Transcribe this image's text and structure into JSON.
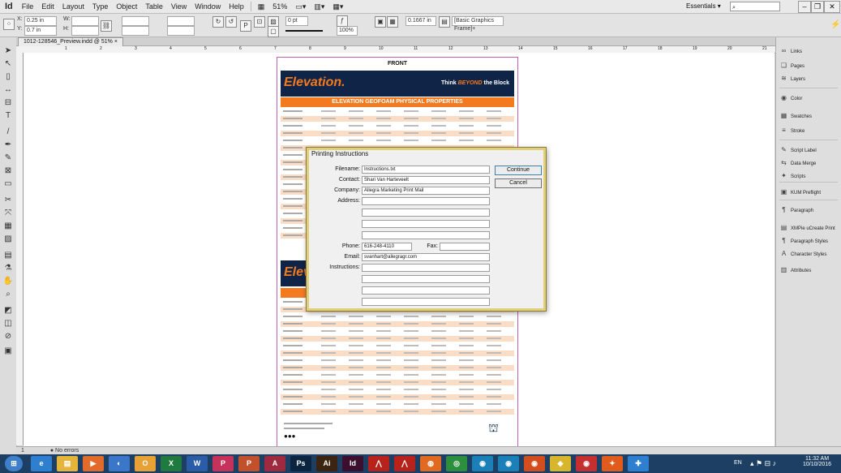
{
  "app": {
    "logo": "Id",
    "menu": [
      "File",
      "Edit",
      "Layout",
      "Type",
      "Object",
      "Table",
      "View",
      "Window",
      "Help"
    ],
    "zoom": "51%",
    "workspace": "Essentials",
    "window_buttons": [
      "–",
      "❐",
      "✕"
    ]
  },
  "controlbar": {
    "x": "0.25 in",
    "y": "0.7 in",
    "w_label": "W:",
    "h_label": "H:",
    "x_label": "X:",
    "y_label": "Y:",
    "stroke": "0 pt",
    "opacity": "100%",
    "width_value": "0.1667 in",
    "frame_style": "[Basic Graphics Frame]+"
  },
  "document": {
    "tab": "1012-128546_Preview.indd @ 51%",
    "close": "×",
    "ruler_ticks": [
      "1",
      "2",
      "3",
      "4",
      "5",
      "6",
      "7",
      "8",
      "9",
      "10",
      "11",
      "12",
      "13",
      "14",
      "15",
      "16",
      "17",
      "18",
      "19",
      "20",
      "21"
    ]
  },
  "page": {
    "title": "FRONT",
    "brand": "Elevation.",
    "tag_pre": "Think ",
    "tag_em": "BEYOND",
    "tag_post": " the Block",
    "heading": "ELEVATION GEOFOAM PHYSICAL PROPERTIES",
    "brand_small": "Elev"
  },
  "dialog": {
    "title": "Printing Instructions",
    "filename_label": "Filename:",
    "filename": "Instructions.txt",
    "contact_label": "Contact:",
    "contact": "Shari Van Harteveelt",
    "company_label": "Company:",
    "company": "Allegra Marketing Print Mail",
    "address_label": "Address:",
    "phone_label": "Phone:",
    "phone": "616-248-4110",
    "fax_label": "Fax:",
    "email_label": "Email:",
    "email": "svanhart@allegragr.com",
    "instructions_label": "Instructions:",
    "continue": "Continue",
    "cancel": "Cancel"
  },
  "panels": [
    {
      "icon": "links-icon",
      "glyph": "∞",
      "label": "Links"
    },
    {
      "icon": "pages-icon",
      "glyph": "❏",
      "label": "Pages"
    },
    {
      "icon": "layers-icon",
      "glyph": "≋",
      "label": "Layers"
    },
    {
      "icon": "color-icon",
      "glyph": "◉",
      "label": "Color"
    },
    {
      "icon": "swatches-icon",
      "glyph": "▦",
      "label": "Swatches"
    },
    {
      "icon": "stroke-icon",
      "glyph": "≡",
      "label": "Stroke"
    },
    {
      "icon": "script-label-icon",
      "glyph": "✎",
      "label": "Script Label"
    },
    {
      "icon": "data-merge-icon",
      "glyph": "⇆",
      "label": "Data Merge"
    },
    {
      "icon": "scripts-icon",
      "glyph": "✦",
      "label": "Scripts"
    },
    {
      "icon": "preflight-icon",
      "glyph": "▣",
      "label": "KUM Preflight"
    },
    {
      "icon": "paragraph-icon",
      "glyph": "¶",
      "label": "Paragraph"
    },
    {
      "icon": "xmpie-icon",
      "glyph": "▤",
      "label": "XMPie uCreate Print"
    },
    {
      "icon": "paragraph-styles-icon",
      "glyph": "¶",
      "label": "Paragraph Styles"
    },
    {
      "icon": "character-styles-icon",
      "glyph": "A",
      "label": "Character Styles"
    },
    {
      "icon": "attributes-icon",
      "glyph": "▥",
      "label": "Attributes"
    }
  ],
  "status": {
    "page": "1",
    "errors": "No errors",
    "zoom_nav": "◂ ▸"
  },
  "taskbar": {
    "start": "⊞",
    "apps": [
      {
        "name": "taskbar-ie",
        "label": "e",
        "color": "#2f7fd1"
      },
      {
        "name": "taskbar-explorer",
        "label": "▤",
        "color": "#e4b53a"
      },
      {
        "name": "taskbar-media",
        "label": "▶",
        "color": "#e26a2b"
      },
      {
        "name": "taskbar-app4",
        "label": "◐",
        "color": "#3a77c8"
      },
      {
        "name": "taskbar-outlook",
        "label": "O",
        "color": "#e8a135"
      },
      {
        "name": "taskbar-excel",
        "label": "X",
        "color": "#1f7a40"
      },
      {
        "name": "taskbar-word",
        "label": "W",
        "color": "#2b5ca8"
      },
      {
        "name": "taskbar-publisher",
        "label": "P",
        "color": "#c7325a"
      },
      {
        "name": "taskbar-powerpoint",
        "label": "P",
        "color": "#c2512b"
      },
      {
        "name": "taskbar-access",
        "label": "A",
        "color": "#9f2a40"
      },
      {
        "name": "taskbar-photoshop",
        "label": "Ps",
        "color": "#0b2540"
      },
      {
        "name": "taskbar-illustrator",
        "label": "Ai",
        "color": "#3d2410"
      },
      {
        "name": "taskbar-indesign",
        "label": "Id",
        "color": "#3c0f2f"
      },
      {
        "name": "taskbar-acrobat",
        "label": "⋀",
        "color": "#b7231a"
      },
      {
        "name": "taskbar-acrobat2",
        "label": "⋀",
        "color": "#b7231a"
      },
      {
        "name": "taskbar-firefox",
        "label": "◍",
        "color": "#e06a1f"
      },
      {
        "name": "taskbar-chrome",
        "label": "◎",
        "color": "#2c8f3d"
      },
      {
        "name": "taskbar-app18",
        "label": "◉",
        "color": "#1b7fb8"
      },
      {
        "name": "taskbar-app19",
        "label": "◉",
        "color": "#1b7fb8"
      },
      {
        "name": "taskbar-app20",
        "label": "◉",
        "color": "#d44d1c"
      },
      {
        "name": "taskbar-app21",
        "label": "◆",
        "color": "#d8b62c"
      },
      {
        "name": "taskbar-app22",
        "label": "◉",
        "color": "#c52f2f"
      },
      {
        "name": "taskbar-app23",
        "label": "✦",
        "color": "#e05b1c"
      },
      {
        "name": "taskbar-app24",
        "label": "✚",
        "color": "#2f7fd1"
      }
    ],
    "lang": "EN",
    "time": "11:32 AM",
    "date": "10/10/2016"
  }
}
